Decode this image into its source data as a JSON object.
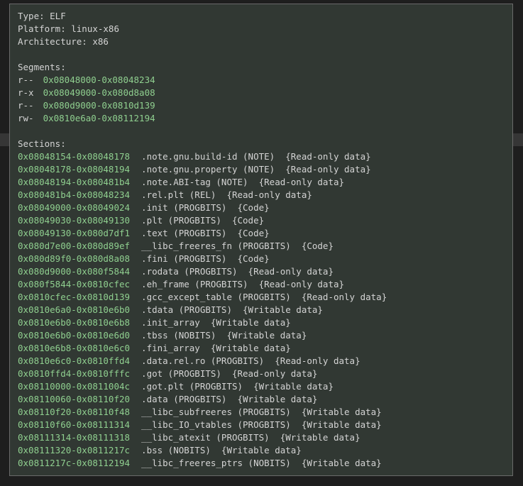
{
  "header": {
    "type_line": "Type: ELF",
    "platform_line": "Platform: linux-x86",
    "arch_line": "Architecture: x86"
  },
  "segments_title": "Segments:",
  "segments": [
    {
      "perm": "r--",
      "range": "0x08048000-0x08048234"
    },
    {
      "perm": "r-x",
      "range": "0x08049000-0x080d8a08"
    },
    {
      "perm": "r--",
      "range": "0x080d9000-0x0810d139"
    },
    {
      "perm": "rw-",
      "range": "0x0810e6a0-0x08112194"
    }
  ],
  "sections_title": "Sections:",
  "sections": [
    {
      "range": "0x08048154-0x08048178",
      "desc": ".note.gnu.build-id (NOTE)  {Read-only data}"
    },
    {
      "range": "0x08048178-0x08048194",
      "desc": ".note.gnu.property (NOTE)  {Read-only data}"
    },
    {
      "range": "0x08048194-0x080481b4",
      "desc": ".note.ABI-tag (NOTE)  {Read-only data}"
    },
    {
      "range": "0x080481b4-0x08048234",
      "desc": ".rel.plt (REL)  {Read-only data}"
    },
    {
      "range": "0x08049000-0x08049024",
      "desc": ".init (PROGBITS)  {Code}"
    },
    {
      "range": "0x08049030-0x08049130",
      "desc": ".plt (PROGBITS)  {Code}"
    },
    {
      "range": "0x08049130-0x080d7df1",
      "desc": ".text (PROGBITS)  {Code}"
    },
    {
      "range": "0x080d7e00-0x080d89ef",
      "desc": "__libc_freeres_fn (PROGBITS)  {Code}"
    },
    {
      "range": "0x080d89f0-0x080d8a08",
      "desc": ".fini (PROGBITS)  {Code}"
    },
    {
      "range": "0x080d9000-0x080f5844",
      "desc": ".rodata (PROGBITS)  {Read-only data}"
    },
    {
      "range": "0x080f5844-0x0810cfec",
      "desc": ".eh_frame (PROGBITS)  {Read-only data}"
    },
    {
      "range": "0x0810cfec-0x0810d139",
      "desc": ".gcc_except_table (PROGBITS)  {Read-only data}"
    },
    {
      "range": "0x0810e6a0-0x0810e6b0",
      "desc": ".tdata (PROGBITS)  {Writable data}"
    },
    {
      "range": "0x0810e6b0-0x0810e6b8",
      "desc": ".init_array  {Writable data}"
    },
    {
      "range": "0x0810e6b0-0x0810e6d0",
      "desc": ".tbss (NOBITS)  {Writable data}"
    },
    {
      "range": "0x0810e6b8-0x0810e6c0",
      "desc": ".fini_array  {Writable data}"
    },
    {
      "range": "0x0810e6c0-0x0810ffd4",
      "desc": ".data.rel.ro (PROGBITS)  {Read-only data}"
    },
    {
      "range": "0x0810ffd4-0x0810fffc",
      "desc": ".got (PROGBITS)  {Read-only data}"
    },
    {
      "range": "0x08110000-0x0811004c",
      "desc": ".got.plt (PROGBITS)  {Writable data}"
    },
    {
      "range": "0x08110060-0x08110f20",
      "desc": ".data (PROGBITS)  {Writable data}"
    },
    {
      "range": "0x08110f20-0x08110f48",
      "desc": "__libc_subfreeres (PROGBITS)  {Writable data}"
    },
    {
      "range": "0x08110f60-0x08111314",
      "desc": "__libc_IO_vtables (PROGBITS)  {Writable data}"
    },
    {
      "range": "0x08111314-0x08111318",
      "desc": "__libc_atexit (PROGBITS)  {Writable data}"
    },
    {
      "range": "0x08111320-0x0811217c",
      "desc": ".bss (NOBITS)  {Writable data}"
    },
    {
      "range": "0x0811217c-0x08112194",
      "desc": "__libc_freeres_ptrs (NOBITS)  {Writable data}"
    }
  ]
}
